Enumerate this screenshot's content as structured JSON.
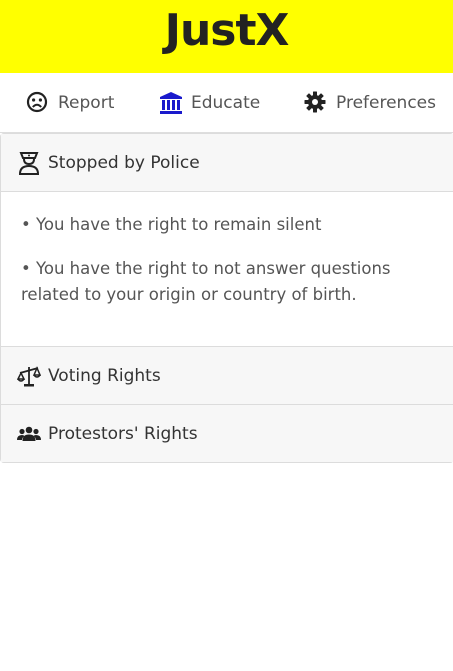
{
  "app": {
    "title": "JustX"
  },
  "tabs": {
    "report": {
      "label": "Report",
      "icon": "frown-face-icon"
    },
    "educate": {
      "label": "Educate",
      "icon": "bank-icon"
    },
    "preferences": {
      "label": "Preferences",
      "icon": "gear-icon"
    }
  },
  "sections": {
    "police": {
      "title": "Stopped by Police",
      "icon": "police-officer-icon",
      "items": [
        "• You have the right to remain silent",
        "• You have the right to not answer questions related to your origin or country of birth."
      ]
    },
    "voting": {
      "title": "Voting Rights",
      "icon": "balance-scale-icon"
    },
    "protestors": {
      "title": "Protestors' Rights",
      "icon": "users-icon"
    }
  },
  "colors": {
    "header_bg": "#ffff00",
    "educate_icon": "#1a1acc"
  }
}
